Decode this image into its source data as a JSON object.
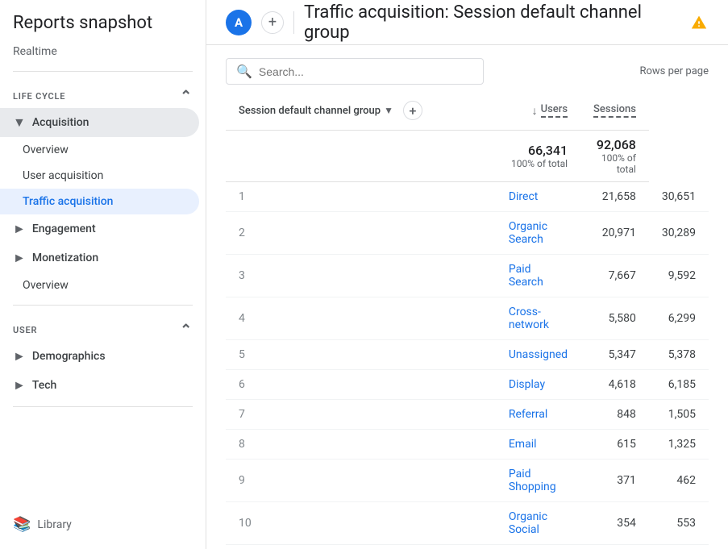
{
  "sidebar": {
    "title": "Reports snapshot",
    "realtime": "Realtime",
    "sections": [
      {
        "label": "Life cycle",
        "items": [
          {
            "id": "acquisition",
            "label": "Acquisition",
            "type": "parent",
            "open": true
          },
          {
            "id": "overview",
            "label": "Overview",
            "type": "child"
          },
          {
            "id": "user-acquisition",
            "label": "User acquisition",
            "type": "child"
          },
          {
            "id": "traffic-acquisition",
            "label": "Traffic acquisition",
            "type": "child",
            "active": true
          },
          {
            "id": "engagement",
            "label": "Engagement",
            "type": "parent"
          },
          {
            "id": "monetization",
            "label": "Monetization",
            "type": "parent"
          },
          {
            "id": "lifecycle-overview",
            "label": "Overview",
            "type": "child-solo"
          }
        ]
      },
      {
        "label": "User",
        "items": [
          {
            "id": "demographics",
            "label": "Demographics",
            "type": "parent"
          },
          {
            "id": "tech",
            "label": "Tech",
            "type": "parent"
          }
        ]
      }
    ],
    "library": "Library"
  },
  "topbar": {
    "avatar_letter": "A",
    "title": "Traffic acquisition: Session default channel group",
    "warning": true
  },
  "table": {
    "search_placeholder": "Search...",
    "rows_per_page_label": "Rows per page",
    "column_group": "Session default channel group",
    "col_users": "Users",
    "col_sessions": "Sessions",
    "total_users": "66,341",
    "total_sessions": "92,068",
    "total_pct": "100% of total",
    "rows": [
      {
        "rank": 1,
        "channel": "Direct",
        "users": "21,658",
        "sessions": "30,651"
      },
      {
        "rank": 2,
        "channel": "Organic Search",
        "users": "20,971",
        "sessions": "30,289"
      },
      {
        "rank": 3,
        "channel": "Paid Search",
        "users": "7,667",
        "sessions": "9,592"
      },
      {
        "rank": 4,
        "channel": "Cross-network",
        "users": "5,580",
        "sessions": "6,299"
      },
      {
        "rank": 5,
        "channel": "Unassigned",
        "users": "5,347",
        "sessions": "5,378"
      },
      {
        "rank": 6,
        "channel": "Display",
        "users": "4,618",
        "sessions": "6,185"
      },
      {
        "rank": 7,
        "channel": "Referral",
        "users": "848",
        "sessions": "1,505"
      },
      {
        "rank": 8,
        "channel": "Email",
        "users": "615",
        "sessions": "1,325"
      },
      {
        "rank": 9,
        "channel": "Paid Shopping",
        "users": "371",
        "sessions": "462"
      },
      {
        "rank": 10,
        "channel": "Organic Social",
        "users": "354",
        "sessions": "553"
      }
    ]
  }
}
